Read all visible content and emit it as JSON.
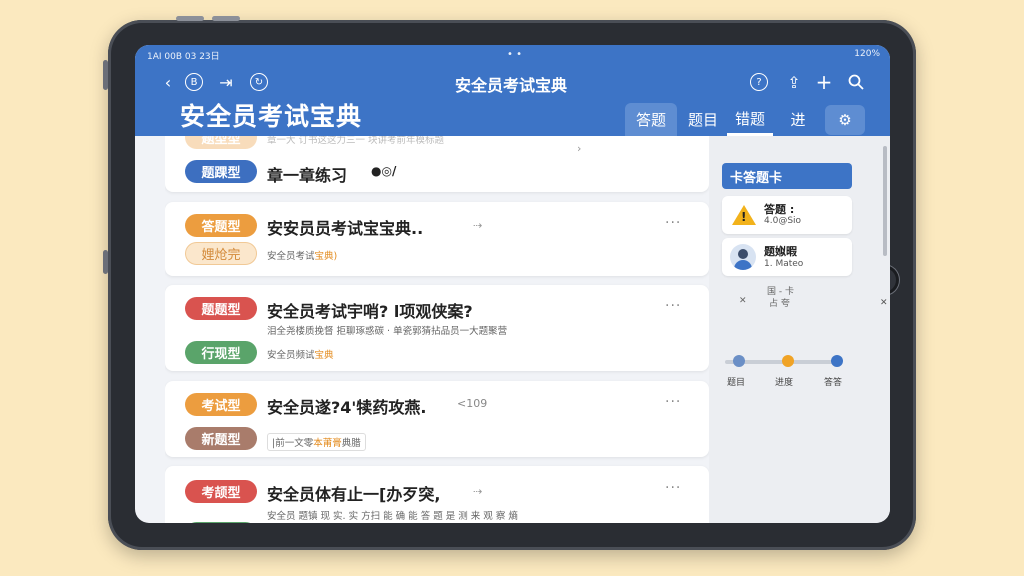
{
  "status": {
    "time": "1AI 00B 03 23日",
    "battery": "120%"
  },
  "nav": {
    "title": "安全员考试宝典",
    "heading": "安全员考试宝典",
    "icons": [
      "back-icon",
      "b-circle-icon",
      "forward-icon",
      "refresh-icon",
      "help-icon",
      "share-icon",
      "plus-icon",
      "search-icon"
    ],
    "circle_b": "B",
    "tabs": [
      {
        "label": "答题"
      },
      {
        "label": "题目"
      },
      {
        "label": "错题"
      },
      {
        "label": "进"
      }
    ]
  },
  "cards": [
    {
      "tag1": "题型型",
      "tag2": "题踝型",
      "title_top": "章一大 订书这这力三一 块讲考前年模标题",
      "title": "章一章练习",
      "extra": "●◎/"
    },
    {
      "tag1": "答题型",
      "tag2": "娌炝完",
      "title": "安安员员考试宝宝典..",
      "sub_prefix": "安全员考试",
      "sub_hl": "宝典)",
      "arrow": "⇢"
    },
    {
      "tag1": "题题型",
      "tag2": "行现型",
      "title": "安全员考试宇哨? l项观侠案?",
      "sub1": "泪全尧楼质挽督 拒聊琢惑碳 · 单瓷郭猜拈品员一大题聚营",
      "sub_prefix": "安全员频试",
      "sub_hl": "宝典"
    },
    {
      "tag1": "考试型",
      "tag2": "新题型",
      "title": "安全员遂?4'犊药攻燕.",
      "side_text": "<109",
      "sub_prefix": "|前一文零",
      "sub_hl": "本莆膏",
      "sub_suffix": "典腊"
    },
    {
      "tag1": "考颉型",
      "title": "安全员体有止一[办歹突,",
      "sub1": "安全员 题镇 现 实. 实 方扫 能 确 能 答 题 是 测 来 观 察 熵",
      "arrow": "⇢"
    }
  ],
  "sidebar": {
    "sheet_label": "卡答题卡",
    "alert": {
      "title": "答题 :",
      "value": "4.0@Sio"
    },
    "user": {
      "name": "题娰暇",
      "value": "1. Mateo"
    },
    "hint_line1": "国 - 卡",
    "hint_line2": "占 夸",
    "close": "✕",
    "pin": "⊤",
    "progress": {
      "labels": [
        "题目",
        "进度",
        "答答"
      ],
      "colors": [
        "#6b8fc6",
        "#f0a326",
        "#3d74c6"
      ]
    }
  },
  "colors": {
    "accent": "#3d74c6",
    "background": "#fbe9bf"
  }
}
